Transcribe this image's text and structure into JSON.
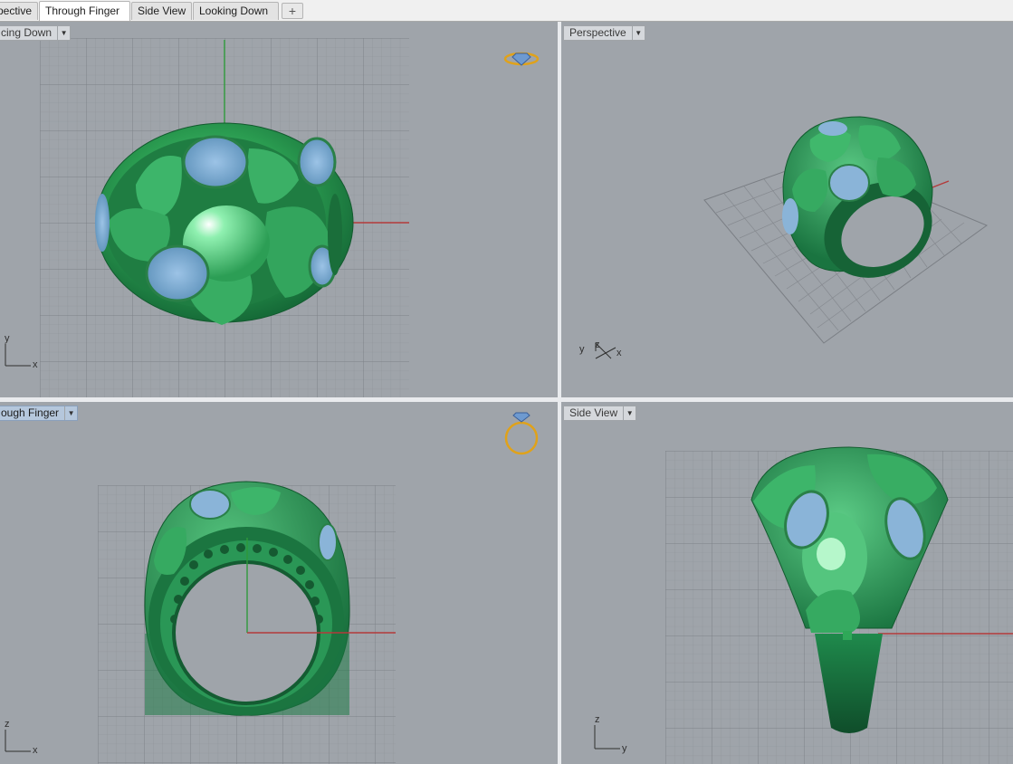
{
  "tabs": [
    {
      "label": "Perspective",
      "visible": "pective"
    },
    {
      "label": "Through Finger"
    },
    {
      "label": "Side View"
    },
    {
      "label": "Looking Down"
    }
  ],
  "add_tab_symbol": "+",
  "viewports": {
    "top_left": {
      "label": "Looking Down",
      "visible": "cing Down",
      "axis_v": "y",
      "axis_h": "x"
    },
    "top_right": {
      "label": "Perspective",
      "axis_v": "z",
      "axis_a": "y",
      "axis_h": "x"
    },
    "bottom_left": {
      "label": "Through Finger",
      "visible": "ough Finger",
      "axis_v": "z",
      "axis_h": "x"
    },
    "bottom_right": {
      "label": "Side View",
      "axis_v": "z",
      "axis_h": "y"
    }
  },
  "colors": {
    "viewport_bg": "#9fa4aa",
    "grid": "#8c9096",
    "axis_x": "#b33a3a",
    "axis_y": "#2e9a3a",
    "ring_green": "#2fa858",
    "gem_blue": "#8ab4d8",
    "gumball_gold": "#e0a21a"
  },
  "icons": [
    "dropdown-arrow-icon",
    "diamond-ring-gumball-icon",
    "plus-icon"
  ]
}
